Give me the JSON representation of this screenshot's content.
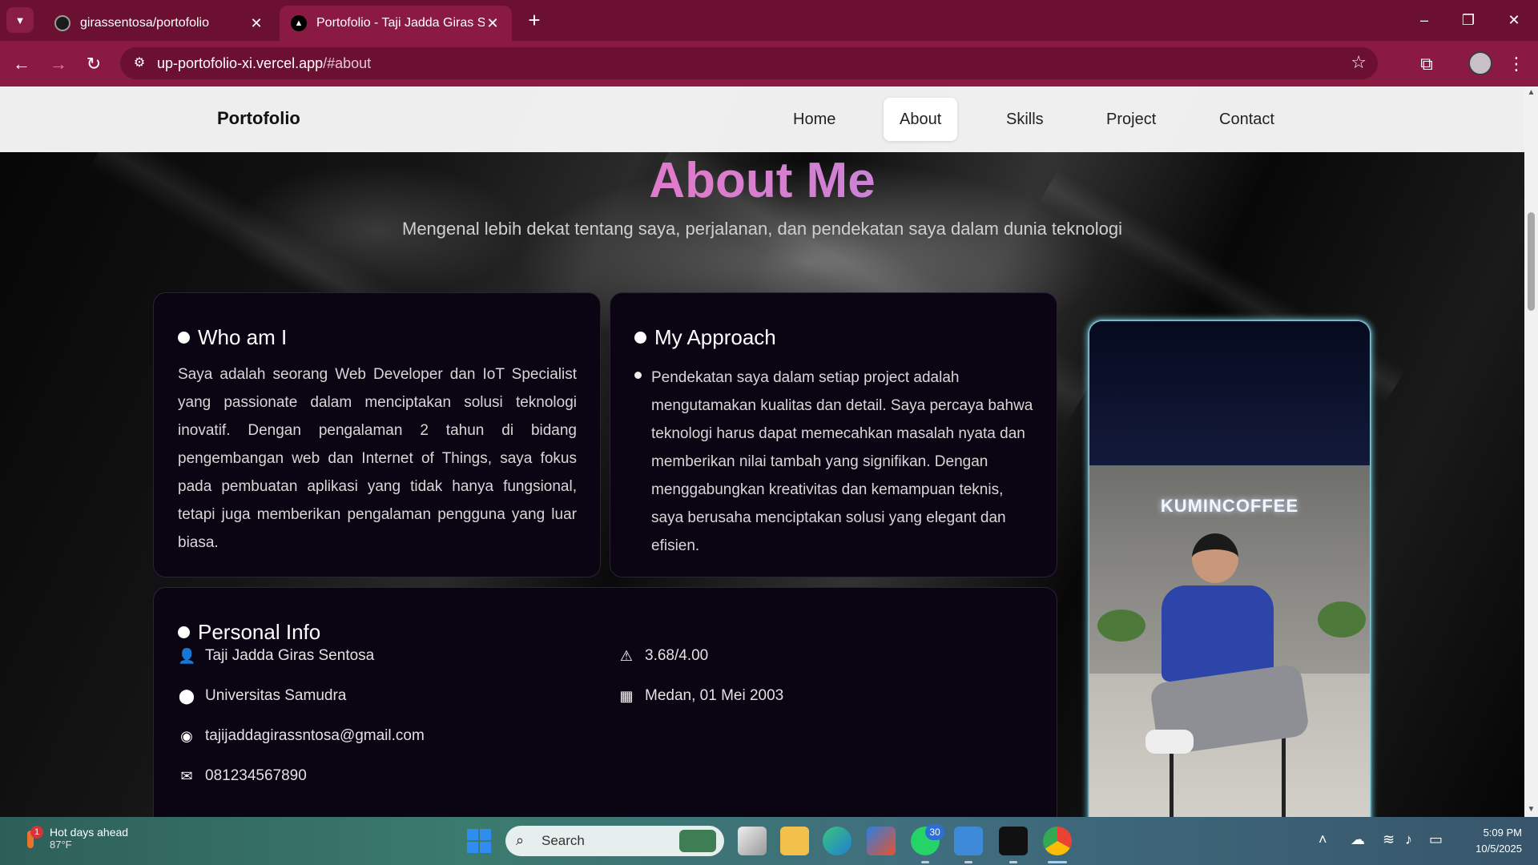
{
  "browser": {
    "tabs": [
      {
        "title": "girassentosa/portofolio",
        "active": false,
        "icon": "github-icon"
      },
      {
        "title": "Portofolio - Taji Jadda Giras Sentosa",
        "active": true,
        "icon": "vercel-icon"
      }
    ],
    "url_host": "up-portofolio-xi.vercel.app",
    "url_path": "/#about"
  },
  "site": {
    "brand": "Portofolio",
    "nav": [
      "Home",
      "About",
      "Skills",
      "Project",
      "Contact"
    ],
    "active_nav": "About"
  },
  "about": {
    "title": "About Me",
    "subtitle": "Mengenal lebih dekat tentang saya, perjalanan, dan pendekatan saya dalam dunia teknologi",
    "who": {
      "title": "Who am I",
      "text": "Saya adalah seorang Web Developer dan IoT Specialist yang passionate dalam menciptakan solusi teknologi inovatif. Dengan pengalaman 2 tahun di bidang pengembangan web dan Internet of Things, saya fokus pada pembuatan aplikasi yang tidak hanya fungsional, tetapi juga memberikan pengalaman pengguna yang luar biasa."
    },
    "approach": {
      "title": "My Approach",
      "text": "Pendekatan saya dalam setiap project adalah mengutamakan kualitas dan detail. Saya percaya bahwa teknologi harus dapat memecahkan masalah nyata dan memberikan nilai tambah yang signifikan. Dengan menggabungkan kreativitas dan kemampuan teknis, saya berusaha menciptakan solusi yang elegant dan efisien."
    },
    "personal": {
      "title": "Personal Info",
      "name": "Taji Jadda Giras Sentosa",
      "university": "Universitas Samudra",
      "email": "tajijaddagirassntosa@gmail.com",
      "phone": "081234567890",
      "gpa": "3.68/4.00",
      "birth": "Medan, 01 Mei 2003"
    },
    "photo_sign": "KUMINCOFFEE"
  },
  "taskbar": {
    "weather_title": "Hot days ahead",
    "weather_temp": "87°F",
    "weather_badge": "1",
    "search_placeholder": "Search",
    "whatsapp_badge": "30",
    "time": "5:09 PM",
    "date": "10/5/2025"
  },
  "colors": {
    "chrome_tabbar": "#6b1030",
    "chrome_toolbar": "#8b1a43",
    "heading_gradient_start": "#c66cf0",
    "heading_gradient_end": "#8a9cff",
    "card_bg": "#0b0413",
    "photo_glow": "#78e6ff"
  }
}
